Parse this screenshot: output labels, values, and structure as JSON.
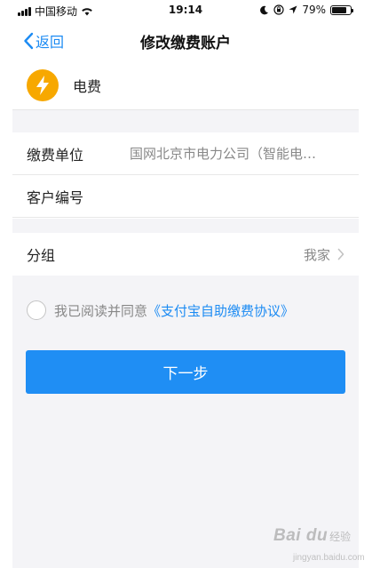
{
  "status_bar": {
    "carrier": "中国移动",
    "time": "19:14",
    "battery": "79%",
    "battery_level": 0.79,
    "icons": [
      "signal-icon",
      "wifi-icon",
      "moon-icon",
      "orientation-lock-icon",
      "location-icon",
      "battery-icon"
    ]
  },
  "nav": {
    "back_label": "返回",
    "title": "修改缴费账户"
  },
  "biller": {
    "icon": "lightning-bolt-icon",
    "icon_color": "#f7a800",
    "name": "电费"
  },
  "form": {
    "unit_label": "缴费单位",
    "unit_value": "国网北京市电力公司（智能电…",
    "customer_label": "客户编号",
    "customer_value": "",
    "customer_placeholder": ""
  },
  "group": {
    "label": "分组",
    "value": "我家"
  },
  "agreement": {
    "text": "我已阅读并同意",
    "link": "《支付宝自助缴费协议》",
    "checked": false
  },
  "next_button": {
    "label": "下一步",
    "color": "#1f8ef4"
  },
  "accent_color": "#1c8bf3",
  "watermark": {
    "brand": "Bai du",
    "sub": "经验",
    "url": "jingyan.baidu.com"
  }
}
